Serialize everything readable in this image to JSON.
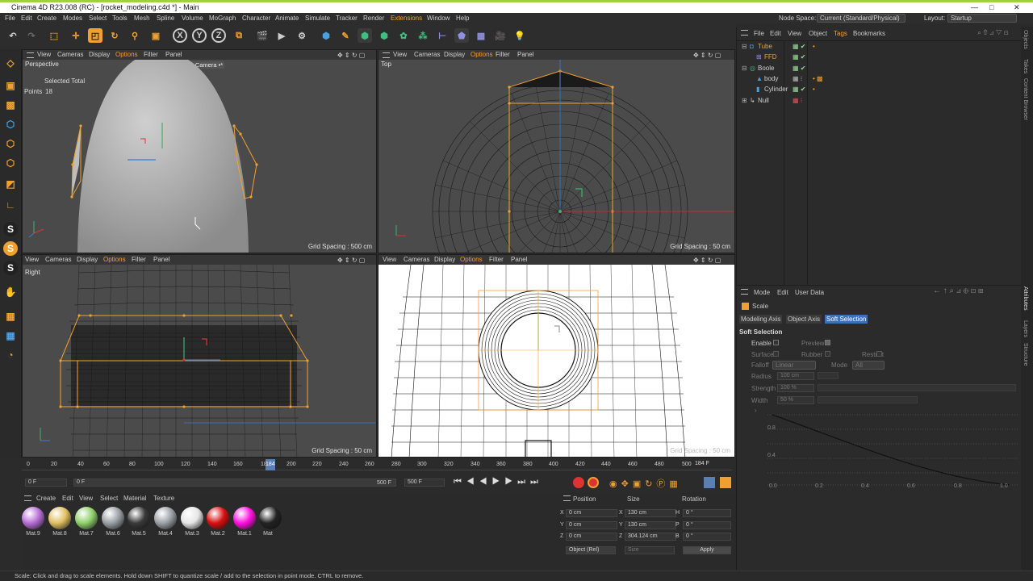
{
  "app": {
    "title": "Cinema 4D R23.008 (RC) - [rocket_modeling.c4d *] - Main",
    "window_controls": {
      "minimize": "—",
      "restore": "□",
      "close": "✕"
    }
  },
  "menubar": {
    "items": [
      "File",
      "Edit",
      "Create",
      "Modes",
      "Select",
      "Tools",
      "Mesh",
      "Spline",
      "Volume",
      "MoGraph",
      "Character",
      "Animate",
      "Simulate",
      "Tracker",
      "Render",
      "Extensions",
      "Window",
      "Help"
    ],
    "node_space_label": "Node Space:",
    "node_space_value": "Current (Standard/Physical)",
    "layout_label": "Layout:",
    "layout_value": "Startup"
  },
  "viewport_menu": {
    "view": "View",
    "cameras": "Cameras",
    "display": "Display",
    "options": "Options",
    "filter": "Filter",
    "panel": "Panel"
  },
  "viewports": {
    "perspective": {
      "name": "Perspective",
      "camera": "Default Camera •*",
      "selected_total": "Selected Total",
      "points_label": "Points",
      "points_value": "18",
      "grid": "Grid Spacing : 500 cm"
    },
    "top": {
      "name": "Top",
      "grid": "Grid Spacing : 50 cm"
    },
    "right": {
      "name": "Right",
      "grid": "Grid Spacing : 50 cm"
    },
    "front": {
      "grid": "Grid Spacing : 50 cm"
    }
  },
  "timeline": {
    "ticks": [
      "0",
      "20",
      "40",
      "60",
      "80",
      "100",
      "120",
      "140",
      "160",
      "180",
      "200",
      "220",
      "240",
      "260",
      "280",
      "300",
      "320",
      "340",
      "360",
      "380",
      "400",
      "420",
      "440",
      "460",
      "480",
      "500"
    ],
    "playhead_label": "184",
    "current_frame": "184 F",
    "start": "0 F",
    "start2": "0 F",
    "end": "500 F",
    "end2": "500 F"
  },
  "material_manager": {
    "menu": [
      "Create",
      "Edit",
      "View",
      "Select",
      "Material",
      "Texture"
    ],
    "materials": [
      {
        "name": "Mat.9",
        "color": "#b86fd6"
      },
      {
        "name": "Mat.8",
        "color": "#e0c060"
      },
      {
        "name": "Mat.7",
        "color": "#8fd06a"
      },
      {
        "name": "Mat.6",
        "color": "#9aa0a6"
      },
      {
        "name": "Mat.5",
        "color": "#3a3a3a"
      },
      {
        "name": "Mat.4",
        "color": "#9aa0a6"
      },
      {
        "name": "Mat.3",
        "color": "#e6e6e6"
      },
      {
        "name": "Mat.2",
        "color": "#d81010"
      },
      {
        "name": "Mat.1",
        "color": "#ff10e0"
      },
      {
        "name": "Mat",
        "color": "#222222"
      }
    ]
  },
  "coordinates": {
    "headers": {
      "position": "Position",
      "size": "Size",
      "rotation": "Rotation"
    },
    "rows": [
      {
        "axis": "X",
        "pos": "0 cm",
        "size_axis": "X",
        "size": "130 cm",
        "rot_axis": "H",
        "rot": "0 °"
      },
      {
        "axis": "Y",
        "pos": "0 cm",
        "size_axis": "Y",
        "size": "130 cm",
        "rot_axis": "P",
        "rot": "0 °"
      },
      {
        "axis": "Z",
        "pos": "0 cm",
        "size_axis": "Z",
        "size": "304.124 cm",
        "rot_axis": "B",
        "rot": "0 °"
      }
    ],
    "mode": "Object (Rel)",
    "size_mode": "Size",
    "apply": "Apply"
  },
  "object_manager": {
    "menu": [
      "File",
      "Edit",
      "View",
      "Object",
      "Tags",
      "Bookmarks"
    ],
    "objects": [
      {
        "name": "Tube",
        "color": "#f0a030",
        "indent": 0
      },
      {
        "name": "FFD",
        "color": "#f0a030",
        "indent": 1
      },
      {
        "name": "Boole",
        "color": "#d0d0d0",
        "indent": 0
      },
      {
        "name": "body",
        "color": "#d0d0d0",
        "indent": 1
      },
      {
        "name": "Cylinder",
        "color": "#d0d0d0",
        "indent": 1
      },
      {
        "name": "Null",
        "color": "#d0d0d0",
        "indent": 0
      }
    ]
  },
  "attribute_manager": {
    "menu": [
      "Mode",
      "Edit",
      "User Data"
    ],
    "tool": "Scale",
    "tabs": [
      "Modeling Axis",
      "Object Axis",
      "Soft Selection"
    ],
    "section": "Soft Selection",
    "enable": "Enable",
    "preview": "Preview",
    "surface": "Surface",
    "rubber": "Rubber",
    "restrict": "Restrict",
    "falloff_label": "Falloff",
    "falloff_value": "Linear",
    "mode_label": "Mode",
    "mode_value": "All",
    "radius_label": "Radius",
    "radius_value": "100 cm",
    "strength_label": "Strength",
    "strength_value": "100 %",
    "width_label": "Width",
    "width_value": "50 %",
    "curve_y": [
      "0.8",
      "0.4"
    ],
    "curve_x": [
      "0.0",
      "0.2",
      "0.4",
      "0.6",
      "0.8",
      "1.0"
    ]
  },
  "right_strip": [
    "Objects",
    "Takes",
    "Content Browser",
    "Attributes",
    "Layers",
    "Structure"
  ],
  "status": "Scale: Click and drag to scale elements. Hold down SHIFT to quantize scale / add to the selection in point mode. CTRL to remove."
}
